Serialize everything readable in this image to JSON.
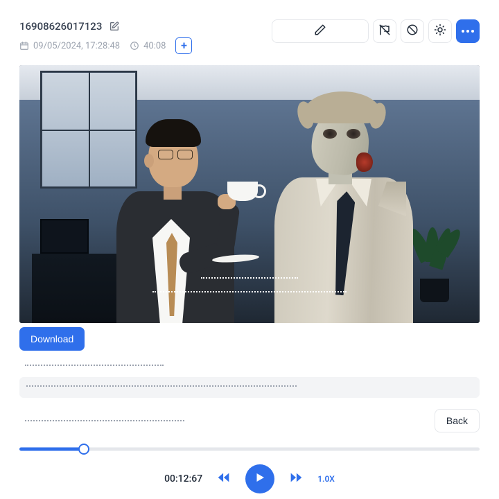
{
  "header": {
    "id_title": "16908626017123",
    "datetime": "09/05/2024, 17:28:48",
    "duration": "40:08"
  },
  "actions": {
    "download_label": "Download",
    "back_label": "Back"
  },
  "player": {
    "current_time": "00:12:67",
    "speed_label": "1.0X",
    "progress_percent": 14
  }
}
